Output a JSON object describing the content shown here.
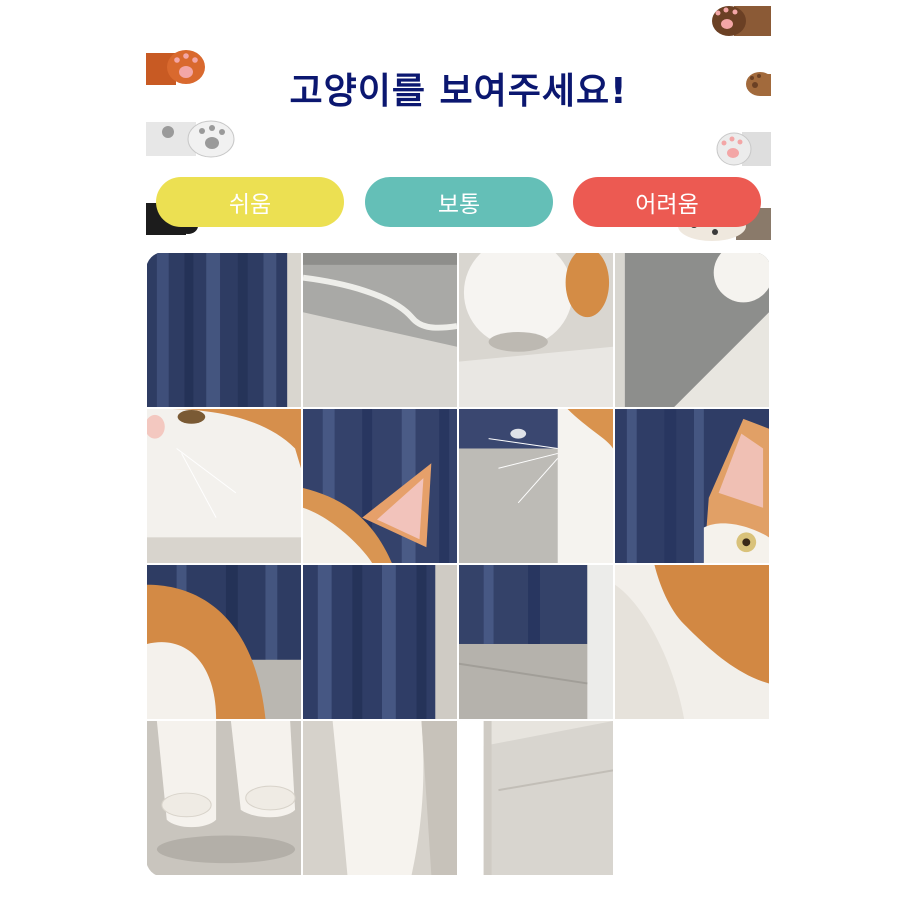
{
  "title": "고양이를 보여주세요!",
  "levels": [
    {
      "label": "쉬움",
      "color": "#ece052"
    },
    {
      "label": "보통",
      "color": "#64bfb7"
    },
    {
      "label": "어려움",
      "color": "#ec5a52"
    }
  ],
  "board": {
    "size": 4,
    "empty_slot": 15,
    "tile_order": [
      "curtain",
      "floor-cable",
      "cat-body-top",
      "floor-shadow",
      "cat-face-left",
      "cat-ear",
      "cat-whiskers",
      "cat-eye-right",
      "cat-back-orange",
      "curtain-dark",
      "curtain-floor",
      "cat-flank",
      "cat-paws",
      "cat-leg",
      "stool-leg"
    ]
  }
}
